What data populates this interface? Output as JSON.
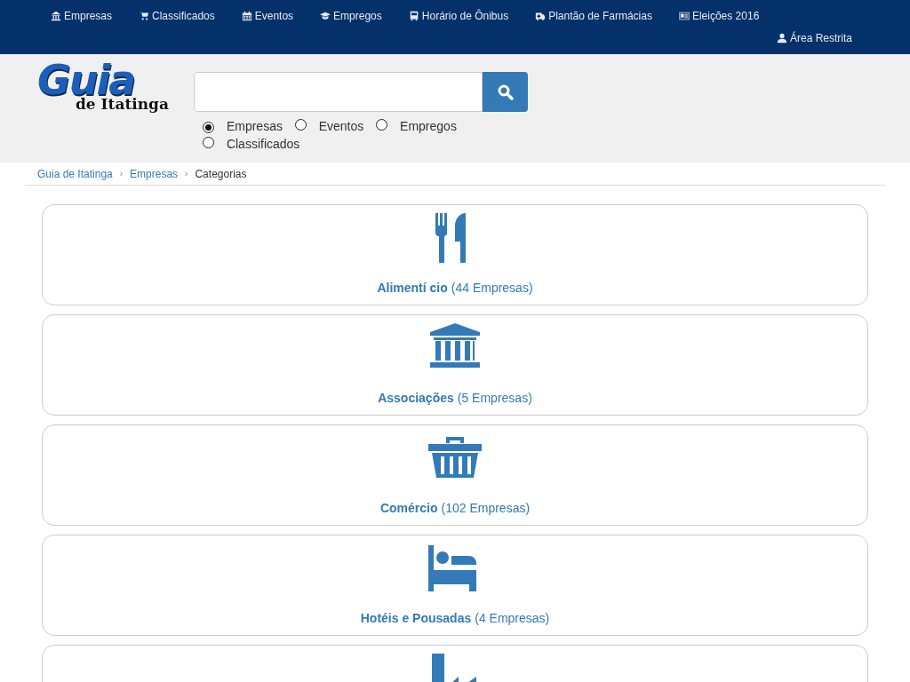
{
  "nav": [
    {
      "label": "Empresas"
    },
    {
      "label": "Classificados"
    },
    {
      "label": "Eventos"
    },
    {
      "label": "Empregos"
    },
    {
      "label": "Horário de Ônibus"
    },
    {
      "label": "Plantão de Farmácias"
    },
    {
      "label": "Eleições 2016"
    }
  ],
  "restricted": {
    "label": "Área Restrita"
  },
  "logo": {
    "title": "Guia",
    "subtitle": "de Itatinga"
  },
  "search_options": [
    {
      "label": "Empresas",
      "selected": true
    },
    {
      "label": "Eventos",
      "selected": false
    },
    {
      "label": "Empregos",
      "selected": false
    },
    {
      "label": "Classificados",
      "selected": false
    }
  ],
  "breadcrumb": [
    {
      "label": "Guia de Itatinga"
    },
    {
      "separator": "›",
      "label": "Empresas"
    },
    {
      "separator": "›",
      "label": "Categorias"
    }
  ],
  "categories": [
    {
      "kind": "food",
      "name": "Alimentí cio",
      "count": "(44 Empresas)"
    },
    {
      "kind": "institution",
      "name": "Associações",
      "count": "(5 Empresas)"
    },
    {
      "kind": "shop",
      "name": "Comércio",
      "count": "(102 Empresas)"
    },
    {
      "kind": "lodging",
      "name": "Hotéis e Pousadas",
      "count": "(4 Empresas)"
    },
    {
      "kind": "industry"
    }
  ]
}
